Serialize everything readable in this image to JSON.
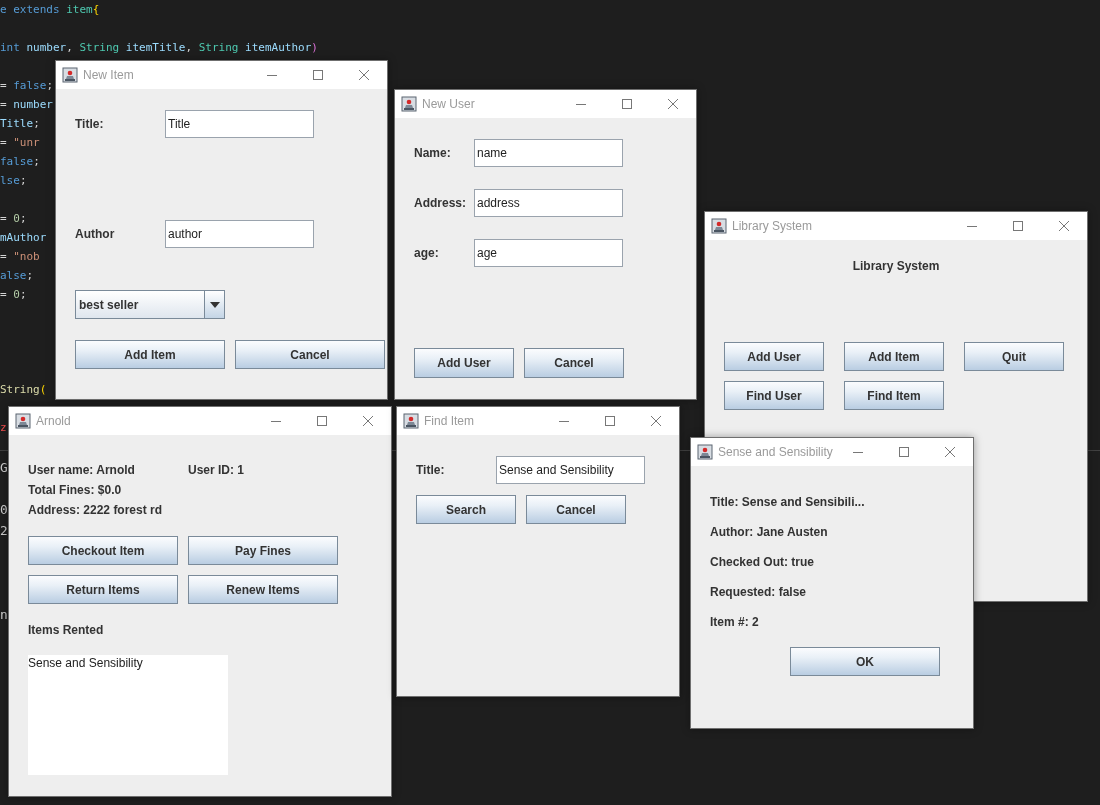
{
  "code_lines": [
    {
      "kind": "code",
      "tokens": [
        {
          "kind": "keyword",
          "text": "e extends "
        },
        {
          "kind": "type",
          "text": "item"
        },
        {
          "kind": "brace",
          "text": "{"
        }
      ]
    },
    {
      "kind": "blank"
    },
    {
      "kind": "code",
      "tokens": [
        {
          "kind": "keyword",
          "text": "int"
        },
        {
          "kind": "variable",
          "text": " number"
        },
        {
          "kind": "punct",
          "text": ", "
        },
        {
          "kind": "type",
          "text": "String"
        },
        {
          "kind": "variable",
          "text": " itemTitle"
        },
        {
          "kind": "punct",
          "text": ", "
        },
        {
          "kind": "type",
          "text": "String"
        },
        {
          "kind": "variable",
          "text": " itemAuthor"
        },
        {
          "kind": "paren",
          "text": ")"
        }
      ]
    },
    {
      "kind": "blank"
    },
    {
      "kind": "code",
      "tokens": [
        {
          "kind": "punct",
          "text": "= "
        },
        {
          "kind": "keyword",
          "text": "false"
        },
        {
          "kind": "punct",
          "text": ";"
        }
      ]
    },
    {
      "kind": "code",
      "tokens": [
        {
          "kind": "punct",
          "text": "= "
        },
        {
          "kind": "variable",
          "text": "number"
        }
      ]
    },
    {
      "kind": "code",
      "tokens": [
        {
          "kind": "variable",
          "text": "Title"
        },
        {
          "kind": "punct",
          "text": ";"
        }
      ]
    },
    {
      "kind": "code",
      "tokens": [
        {
          "kind": "punct",
          "text": "= "
        },
        {
          "kind": "string",
          "text": "\"unr"
        }
      ]
    },
    {
      "kind": "code",
      "tokens": [
        {
          "kind": "keyword",
          "text": "false"
        },
        {
          "kind": "punct",
          "text": ";"
        }
      ]
    },
    {
      "kind": "code",
      "tokens": [
        {
          "kind": "keyword",
          "text": "lse"
        },
        {
          "kind": "punct",
          "text": ";"
        }
      ]
    },
    {
      "kind": "blank"
    },
    {
      "kind": "code",
      "tokens": [
        {
          "kind": "punct",
          "text": "= "
        },
        {
          "kind": "number",
          "text": "0"
        },
        {
          "kind": "punct",
          "text": ";"
        }
      ]
    },
    {
      "kind": "code",
      "tokens": [
        {
          "kind": "variable",
          "text": "mAuthor"
        }
      ]
    },
    {
      "kind": "code",
      "tokens": [
        {
          "kind": "punct",
          "text": "= "
        },
        {
          "kind": "string",
          "text": "\"nob"
        }
      ]
    },
    {
      "kind": "code",
      "tokens": [
        {
          "kind": "keyword",
          "text": "alse"
        },
        {
          "kind": "punct",
          "text": ";"
        }
      ]
    },
    {
      "kind": "code",
      "tokens": [
        {
          "kind": "punct",
          "text": "= "
        },
        {
          "kind": "number",
          "text": "0"
        },
        {
          "kind": "punct",
          "text": ";"
        }
      ]
    },
    {
      "kind": "blank"
    },
    {
      "kind": "blank"
    },
    {
      "kind": "blank"
    },
    {
      "kind": "blank"
    },
    {
      "kind": "code",
      "tokens": [
        {
          "kind": "function",
          "text": "String"
        },
        {
          "kind": "brace",
          "text": "("
        }
      ]
    },
    {
      "kind": "blank"
    },
    {
      "kind": "code",
      "tokens": [
        {
          "kind": "error",
          "text": "z"
        }
      ]
    }
  ],
  "terminal_lines": [
    {
      "kind": "code",
      "text": "G"
    },
    {
      "kind": "blank"
    },
    {
      "kind": "code",
      "text": "0"
    },
    {
      "kind": "code",
      "text": "2"
    },
    {
      "kind": "blank"
    },
    {
      "kind": "blank"
    },
    {
      "kind": "blank"
    },
    {
      "kind": "code",
      "text": "n"
    }
  ],
  "windows": [
    {
      "kind": "new_item",
      "title": "New Item",
      "rows": [
        {
          "kind": "field",
          "label": "Title:",
          "value": "Title"
        },
        {
          "kind": "field",
          "label": "Author",
          "value": "author"
        },
        {
          "kind": "combo",
          "value": "best seller"
        },
        {
          "kind": "buttons",
          "buttons": [
            "Add Item",
            "Cancel"
          ]
        }
      ]
    },
    {
      "kind": "new_user",
      "title": "New User",
      "rows": [
        {
          "kind": "field",
          "label": "Name:",
          "value": "name"
        },
        {
          "kind": "field",
          "label": "Address:",
          "value": "address"
        },
        {
          "kind": "field",
          "label": "age:",
          "value": "age"
        },
        {
          "kind": "buttons",
          "buttons": [
            "Add User",
            "Cancel"
          ]
        }
      ]
    },
    {
      "kind": "library",
      "title": "Library System",
      "rows": [
        {
          "kind": "heading",
          "text": "Library System"
        },
        {
          "kind": "buttons",
          "buttons": [
            "Add User",
            "Add Item",
            "Quit"
          ]
        },
        {
          "kind": "buttons",
          "buttons": [
            "Find User",
            "Find Item"
          ]
        }
      ]
    },
    {
      "kind": "user_detail",
      "title": "Arnold",
      "rows": [
        {
          "kind": "labels",
          "texts": [
            "User name: Arnold",
            "User ID: 1"
          ]
        },
        {
          "kind": "labels",
          "texts": [
            "Total Fines: $0.0"
          ]
        },
        {
          "kind": "labels",
          "texts": [
            "Address: 2222 forest rd"
          ]
        },
        {
          "kind": "buttons",
          "buttons": [
            "Checkout Item",
            "Pay Fines"
          ]
        },
        {
          "kind": "buttons",
          "buttons": [
            "Return Items",
            "Renew Items"
          ]
        },
        {
          "kind": "labels",
          "texts": [
            "Items Rented"
          ]
        },
        {
          "kind": "list",
          "items": [
            "Sense and Sensibility"
          ]
        }
      ]
    },
    {
      "kind": "find_item",
      "title": "Find Item",
      "rows": [
        {
          "kind": "field",
          "label": "Title:",
          "value": "Sense and Sensibility"
        },
        {
          "kind": "buttons",
          "buttons": [
            "Search",
            "Cancel"
          ]
        }
      ]
    },
    {
      "kind": "item_detail",
      "title": "Sense and Sensibility",
      "rows": [
        {
          "kind": "labels",
          "texts": [
            "Title: Sense and Sensibili..."
          ]
        },
        {
          "kind": "labels",
          "texts": [
            "Author: Jane Austen"
          ]
        },
        {
          "kind": "labels",
          "texts": [
            "Checked Out: true"
          ]
        },
        {
          "kind": "labels",
          "texts": [
            "Requested: false"
          ]
        },
        {
          "kind": "labels",
          "texts": [
            "Item #: 2"
          ]
        },
        {
          "kind": "buttons",
          "buttons": [
            "OK"
          ]
        }
      ]
    }
  ]
}
